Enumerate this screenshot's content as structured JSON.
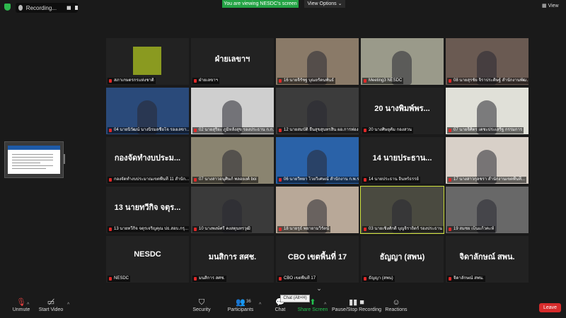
{
  "topbar": {
    "recording_label": "Recording...",
    "viewing_banner": "You are viewing NESDC's screen",
    "view_options": "View Options",
    "view_label": "View"
  },
  "tiles": [
    {
      "caption": "สภาเกษตรกรแห่งชาติ",
      "big": ""
    },
    {
      "caption": "ฝ่ายเลขาฯ",
      "big": "ฝ่ายเลขาฯ"
    },
    {
      "caption": "16 นายจิรัชฐ บุณยรัตนพันธ์",
      "big": ""
    },
    {
      "caption": "Meeting3 NESDC",
      "big": ""
    },
    {
      "caption": "08 นายสุรชัย จิราประดิษฐ์ สำนักงานพัฒนา...",
      "big": ""
    },
    {
      "caption": "04 นายนิวัฒน์ นางนิรมลชื่อโจ รองเลขาธิการ...",
      "big": ""
    },
    {
      "caption": "02 นายสุริยะ ภูมิหลังสุข รองประธาน ก.กศ.ส.",
      "big": ""
    },
    {
      "caption": "12 นายสมบัติ ยืนสุขสุนทรสิน ผอ.การท่องเที่ยว",
      "big": ""
    },
    {
      "caption": "20 นางศิษยุคัม กองสวน",
      "big": "20 นางพิมพ์พร..."
    },
    {
      "caption": "07 นายจิศิตร เตชะประเสริฐ กรรมการ",
      "big": ""
    },
    {
      "caption": "กองจัดทำงบประมาณเขตพื้นที่ 11 สำนัก...",
      "big": "กองจัดทำงบประม..."
    },
    {
      "caption": "07 นางสาวอนุศิษภ์ พลอยงค์ boi",
      "big": ""
    },
    {
      "caption": "06 นายวิทยา ไวยวิเศษณ์ สำนักงาน ก.พ.ร.",
      "big": ""
    },
    {
      "caption": "14 นายประธาน อินทร์ธรรย์",
      "big": "14 นายประธาน..."
    },
    {
      "caption": "17 นางสาวกุลชรา สำนักงานเขตพื้นที่...",
      "big": ""
    },
    {
      "caption": "13 นายทวีกิจ จตุรเจริญคุณ ปธ.สอบ.กรุ...",
      "big": "13 นายทวีกิจ จตุร..."
    },
    {
      "caption": "10 นางพงษ์ศรี คงสตุนทรวุฒิ",
      "big": ""
    },
    {
      "caption": "18 นายรุธ์ พยายามวิรัตน์",
      "big": ""
    },
    {
      "caption": "03 นายเชิงศักดิ์ บุญจิราถิตร์ รองประธาน ก.กศ.",
      "big": ""
    },
    {
      "caption": "19 สมชย เบ็นแก้วคะห์",
      "big": ""
    },
    {
      "caption": "NESDC",
      "big": "NESDC"
    },
    {
      "caption": "มนสิการ สศช.",
      "big": "มนสิการ สศช."
    },
    {
      "caption": "CBO เขตพื้นที่ 17",
      "big": "CBO เขตพื้นที่ 17"
    },
    {
      "caption": "ธัญญา (สพน)",
      "big": "ธัญญา (สพน)"
    },
    {
      "caption": "จิดาลักษณ์ สพน.",
      "big": "จิดาลักษณ์ สพน."
    }
  ],
  "toolbar": {
    "unmute": "Unmute",
    "start_video": "Start Video",
    "security": "Security",
    "participants": "Participants",
    "participants_count": "36",
    "chat": "Chat",
    "share_screen": "Share Screen",
    "record": "Pause/Stop Recording",
    "reactions": "Reactions",
    "leave": "Leave",
    "chat_tooltip": "Chat (Alt+H)"
  },
  "colors": {
    "share_green": "#23a344",
    "leave_red": "#d72b2b",
    "active_speaker": "#cfe13c"
  }
}
